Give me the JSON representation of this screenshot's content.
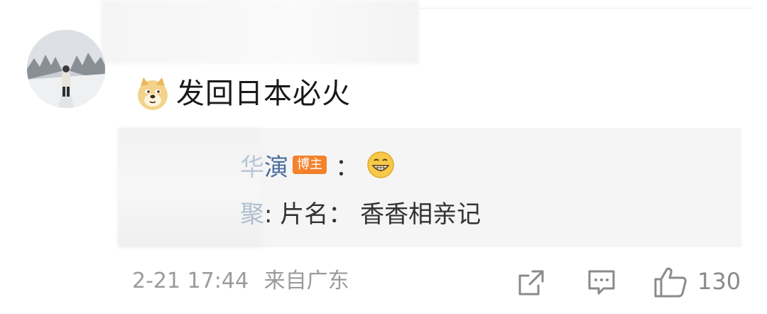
{
  "comment": {
    "text": "发回日本必火",
    "emoji": "doge-icon"
  },
  "reply": {
    "line1_author": "演",
    "line1_author_prefix": "华",
    "badge": "博主",
    "colon": "：",
    "line1_emoji": "grin-icon",
    "line2_author": "聚",
    "line2_text": ": 片名： 香香相亲记"
  },
  "footer": {
    "timestamp": "2-21 17:44",
    "source": "来自广东",
    "like_count": "130"
  },
  "colors": {
    "author_link": "#4b6e9e",
    "badge": "#f4812b",
    "meta_text": "#9b9b9b",
    "reply_bg": "#f5f5f5"
  }
}
